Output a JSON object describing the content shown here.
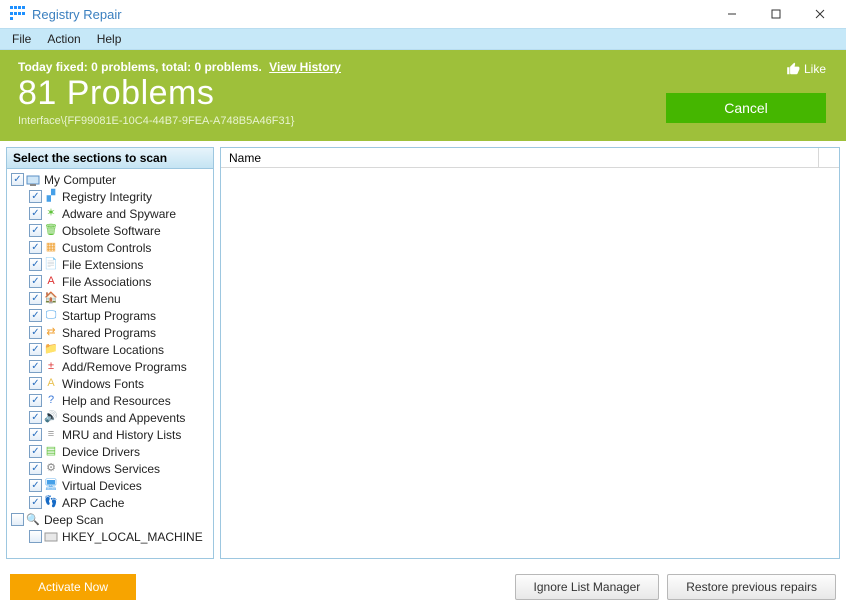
{
  "titlebar": {
    "title": "Registry Repair"
  },
  "menu": {
    "file": "File",
    "action": "Action",
    "help": "Help"
  },
  "banner": {
    "line1_prefix": "Today fixed: 0 problems, total: 0 problems.",
    "view_history": "View History",
    "big": "81 Problems",
    "sub": "Interface\\{FF99081E-10C4-44B7-9FEA-A748B5A46F31}",
    "like": "Like",
    "cancel": "Cancel"
  },
  "left": {
    "header": "Select the sections to scan",
    "root": "My Computer",
    "items": [
      "Registry Integrity",
      "Adware and Spyware",
      "Obsolete Software",
      "Custom Controls",
      "File Extensions",
      "File Associations",
      "Start Menu",
      "Startup Programs",
      "Shared Programs",
      "Software Locations",
      "Add/Remove Programs",
      "Windows Fonts",
      "Help and Resources",
      "Sounds and Appevents",
      "MRU and History Lists",
      "Device Drivers",
      "Windows Services",
      "Virtual Devices",
      "ARP Cache"
    ],
    "deepscan": "Deep Scan",
    "hklm": "HKEY_LOCAL_MACHINE"
  },
  "right": {
    "col_name": "Name"
  },
  "footer": {
    "activate": "Activate Now",
    "ignore": "Ignore List Manager",
    "restore": "Restore previous repairs"
  },
  "item_icons": {
    "0": {
      "glyph": "▞",
      "color": "#46a0e8"
    },
    "1": {
      "glyph": "✶",
      "color": "#5fc23a"
    },
    "2": {
      "glyph": "🗑",
      "color": "#5fc23a"
    },
    "3": {
      "glyph": "▦",
      "color": "#f0a030"
    },
    "4": {
      "glyph": "📄",
      "color": "#888"
    },
    "5": {
      "glyph": "A",
      "color": "#d33"
    },
    "6": {
      "glyph": "🏠",
      "color": "#5fc23a"
    },
    "7": {
      "glyph": "🖵",
      "color": "#46a0e8"
    },
    "8": {
      "glyph": "⇄",
      "color": "#f0a030"
    },
    "9": {
      "glyph": "📁",
      "color": "#e8c050"
    },
    "10": {
      "glyph": "±",
      "color": "#d33"
    },
    "11": {
      "glyph": "A",
      "color": "#e8c050"
    },
    "12": {
      "glyph": "?",
      "color": "#3a78d8"
    },
    "13": {
      "glyph": "🔊",
      "color": "#999"
    },
    "14": {
      "glyph": "≡",
      "color": "#999"
    },
    "15": {
      "glyph": "▤",
      "color": "#5fc23a"
    },
    "16": {
      "glyph": "⚙",
      "color": "#888"
    },
    "17": {
      "glyph": "🖥",
      "color": "#46a0e8"
    },
    "18": {
      "glyph": "👣",
      "color": "#46a0e8"
    }
  }
}
